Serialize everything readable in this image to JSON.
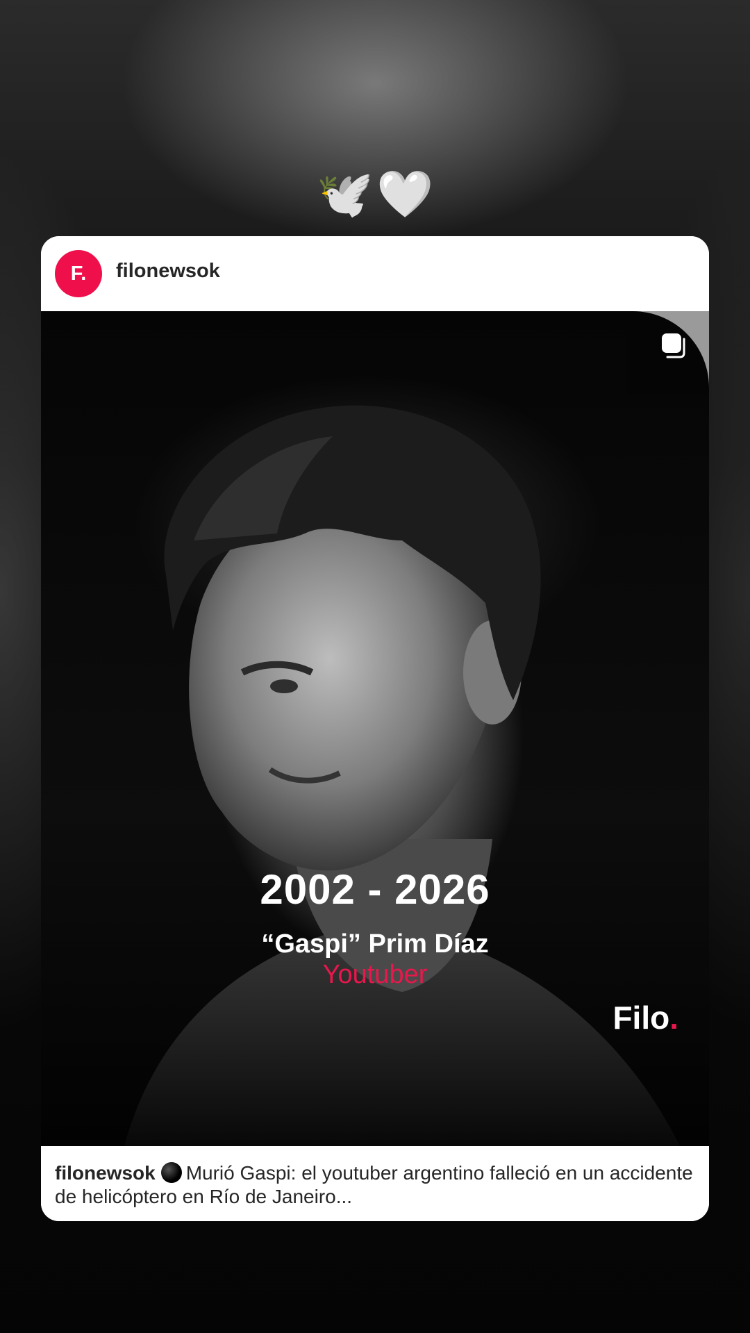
{
  "sticker": {
    "dove": "🕊️",
    "heart": "🤍"
  },
  "post": {
    "avatar_text": "F.",
    "username": "filonewsok",
    "image": {
      "years": "2002 - 2026",
      "name": "“Gaspi” Prim Díaz",
      "role": "Youtuber",
      "brand": "Filo",
      "brand_dot": "."
    },
    "caption": {
      "username": "filonewsok",
      "text": "Murió Gaspi: el youtuber argentino falleció en un accidente de helicóptero en Río de Janeiro..."
    },
    "colors": {
      "accent": "#e8174c",
      "avatar": "#ee0f4b"
    },
    "icons": {
      "multi": "multiple-posts-icon",
      "caption_emoji": "black-circle-icon"
    }
  }
}
